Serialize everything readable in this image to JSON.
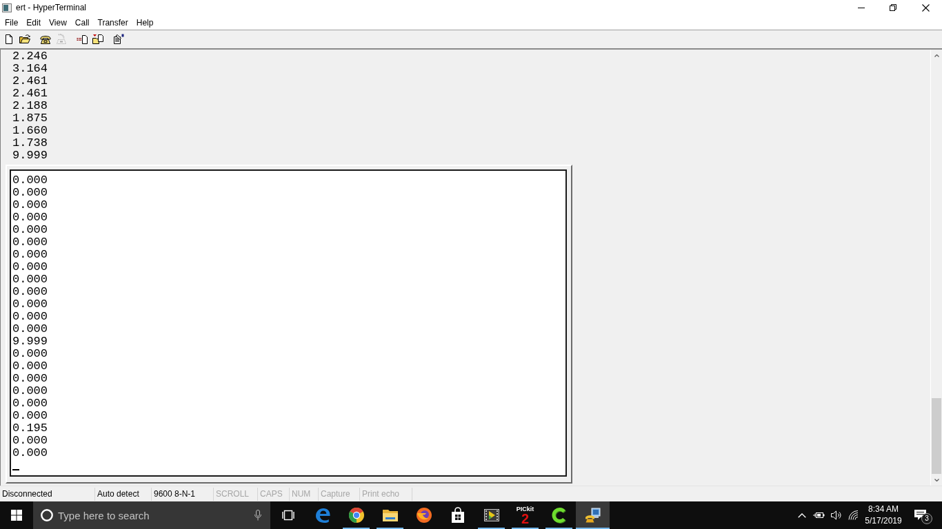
{
  "window": {
    "title": "ert - HyperTerminal"
  },
  "menu": [
    "File",
    "Edit",
    "View",
    "Call",
    "Transfer",
    "Help"
  ],
  "toolbar": [
    [
      {
        "kind": "new",
        "disabled": false
      },
      {
        "kind": "open",
        "disabled": false
      }
    ],
    [
      {
        "kind": "call",
        "disabled": false
      },
      {
        "kind": "disconnect",
        "disabled": true
      }
    ],
    [
      {
        "kind": "send",
        "disabled": false
      },
      {
        "kind": "receive",
        "disabled": false
      }
    ],
    [
      {
        "kind": "properties",
        "disabled": false
      }
    ]
  ],
  "terminal": {
    "scrollback": [
      "2.246",
      "3.164",
      "2.461",
      "2.461",
      "2.188",
      "1.875",
      "1.660",
      "1.738",
      "9.999"
    ],
    "screen": [
      "0.000",
      "0.000",
      "0.000",
      "0.000",
      "0.000",
      "0.000",
      "0.000",
      "0.000",
      "0.000",
      "0.000",
      "0.000",
      "0.000",
      "0.000",
      "9.999",
      "0.000",
      "0.000",
      "0.000",
      "0.000",
      "0.000",
      "0.000",
      "0.195",
      "0.000",
      "0.000"
    ]
  },
  "status_bar": [
    {
      "text": "Disconnected",
      "disabled": false
    },
    {
      "text": "Auto detect",
      "disabled": false
    },
    {
      "text": "9600 8-N-1",
      "disabled": false
    },
    {
      "text": "SCROLL",
      "disabled": true
    },
    {
      "text": "CAPS",
      "disabled": true
    },
    {
      "text": "NUM",
      "disabled": true
    },
    {
      "text": "Capture",
      "disabled": true
    },
    {
      "text": "Print echo",
      "disabled": true
    }
  ],
  "taskbar": {
    "search": {
      "placeholder": "Type here to search"
    },
    "apps": [
      {
        "kind": "edge",
        "running": false,
        "selected": false
      },
      {
        "kind": "chrome",
        "running": true,
        "selected": false
      },
      {
        "kind": "explorer",
        "running": true,
        "selected": false
      },
      {
        "kind": "firefox",
        "running": false,
        "selected": false
      },
      {
        "kind": "store",
        "running": false,
        "selected": false
      },
      {
        "kind": "media",
        "running": true,
        "selected": false
      },
      {
        "kind": "pickit",
        "running": true,
        "selected": false,
        "label": "PICkit",
        "badge": "2"
      },
      {
        "kind": "green_c",
        "running": true,
        "selected": false
      },
      {
        "kind": "hyperterminal",
        "running": true,
        "selected": true
      }
    ],
    "clock": {
      "time": "8:34 AM",
      "date": "5/17/2019"
    },
    "notifications": {
      "count": "3"
    }
  }
}
